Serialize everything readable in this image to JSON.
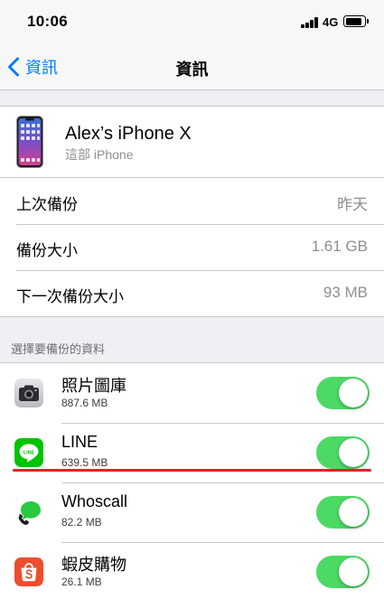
{
  "status_bar": {
    "time": "10:06",
    "network": "4G",
    "signal_bars": 4,
    "battery_level_percent": 90
  },
  "nav": {
    "back_label": "資訊",
    "title": "資訊"
  },
  "device": {
    "name": "Alex’s iPhone X",
    "subtitle": "這部 iPhone"
  },
  "backup_info": [
    {
      "label": "上次備份",
      "value": "昨天"
    },
    {
      "label": "備份大小",
      "value": "1.61 GB"
    },
    {
      "label": "下一次備份大小",
      "value": "93 MB"
    }
  ],
  "section_header": "選擇要備份的資料",
  "apps": [
    {
      "name": "照片圖庫",
      "size": "887.6 MB",
      "icon": "camera-icon",
      "enabled": true
    },
    {
      "name": "LINE",
      "size": "639.5 MB",
      "icon": "line-app-icon",
      "icon_text": "LINE",
      "enabled": true
    },
    {
      "name": "Whoscall",
      "size": "82.2 MB",
      "icon": "whoscall-icon",
      "enabled": true
    },
    {
      "name": "蝦皮購物",
      "size": "26.1 MB",
      "icon": "shopee-icon",
      "enabled": true
    }
  ],
  "colors": {
    "accent": "#007aff",
    "toggle_on": "#4cd964",
    "annotation_red": "#e5231f",
    "line_green": "#00c300",
    "shopee_orange": "#ee4d2d"
  }
}
